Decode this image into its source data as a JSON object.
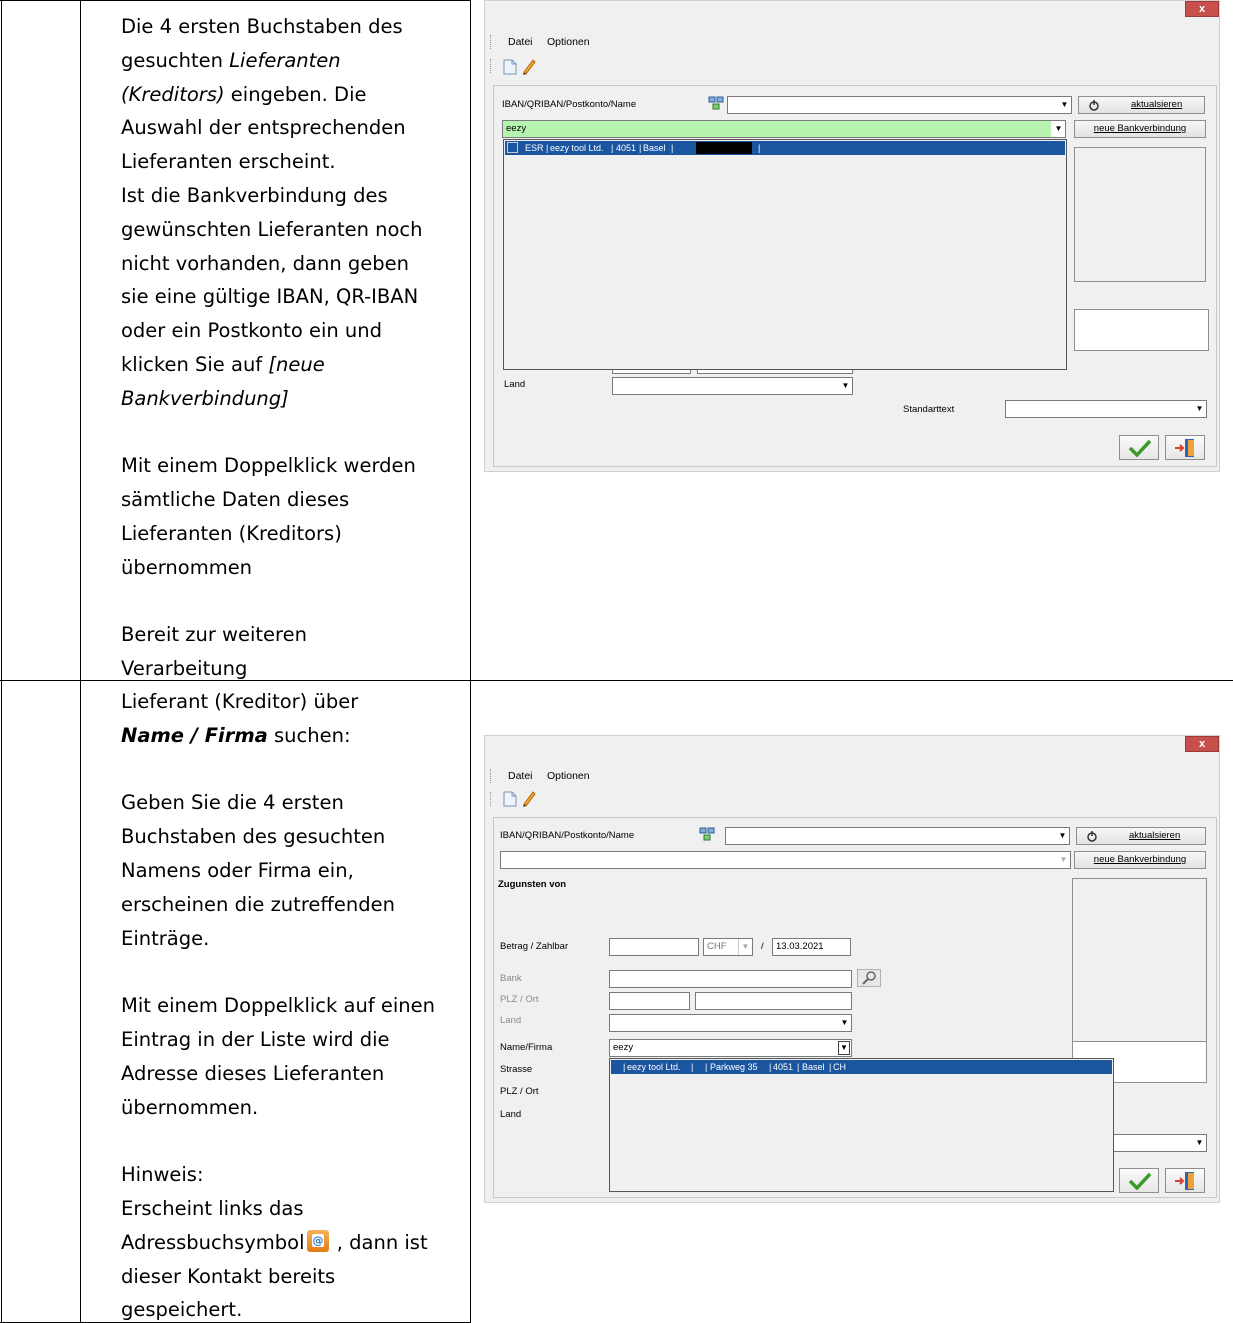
{
  "row1": {
    "instructions": [
      "Die 4 ersten Buchstaben des",
      "gesuchten ",
      "Lieferanten",
      "(Kreditors)",
      " eingeben. Die",
      "Auswahl der entsprechenden",
      "Lieferanten erscheint.",
      "Ist die Bankverbindung des",
      "gewünschten Lieferanten noch",
      "nicht vorhanden, dann geben",
      "sie eine gültige IBAN, QR-IBAN",
      "oder ein Postkonto ein und",
      "klicken Sie auf ",
      "[neue",
      "Bankverbindung]",
      "Mit einem Doppelklick werden",
      "sämtliche Daten dieses",
      "Lieferanten (Kreditors)",
      "übernommen",
      "Bereit zur weiteren",
      "Verarbeitung"
    ],
    "window": {
      "close": "x",
      "menu": [
        "Datei",
        "Optionen"
      ],
      "iban_label": "IBAN/QRIBAN/Postkonto/Name",
      "iban_value": "",
      "refresh_button": "aktualsieren",
      "search_value": "eezy",
      "new_bank_button": "neue Bankverbindung",
      "result_row": {
        "type": "ESR",
        "name": "eezy tool Ltd.",
        "zip": "4051",
        "city": "Basel"
      },
      "land_label": "Land",
      "standard_text_label": "Standarttext"
    }
  },
  "row2": {
    "instructions": [
      "Lieferant (Kreditor) über",
      "Name / Firma",
      " suchen:",
      "Geben Sie die 4 ersten",
      "Buchstaben des gesuchten",
      "Namens oder Firma ein,",
      "erscheinen die zutreffenden",
      "Einträge.",
      "Mit einem Doppelklick auf einen",
      "Eintrag in der Liste wird die",
      "Adresse dieses Lieferanten",
      "übernommen.",
      "Hinweis:",
      "Erscheint links das",
      "Adressbuchsymbol",
      " , dann ist",
      "dieser Kontakt bereits",
      "gespeichert."
    ],
    "window": {
      "close": "x",
      "menu": [
        "Datei",
        "Optionen"
      ],
      "iban_label": "IBAN/QRIBAN/Postkonto/Name",
      "refresh_button": "aktualsieren",
      "new_bank_button": "neue Bankverbindung",
      "zugunsten_label": "Zugunsten von",
      "betrag_label": "Betrag / Zahlbar",
      "currency": "CHF",
      "slash": "/",
      "date": "13.03.2021",
      "bank_label": "Bank",
      "plz_label": "PLZ / Ort",
      "land_label": "Land",
      "name_label": "Name/Firma",
      "name_value": "eezy",
      "strasse_label": "Strasse",
      "plz2_label": "PLZ / Ort",
      "land2_label": "Land",
      "result_row": {
        "name": "eezy tool Ltd.",
        "street": "Parkweg 35",
        "zip": "4051",
        "city": "Basel",
        "country": "CH"
      }
    }
  },
  "colors": {
    "selection": "#1b55a0",
    "search_highlight": "#b6f4b0",
    "close_button": "#c7504c"
  }
}
